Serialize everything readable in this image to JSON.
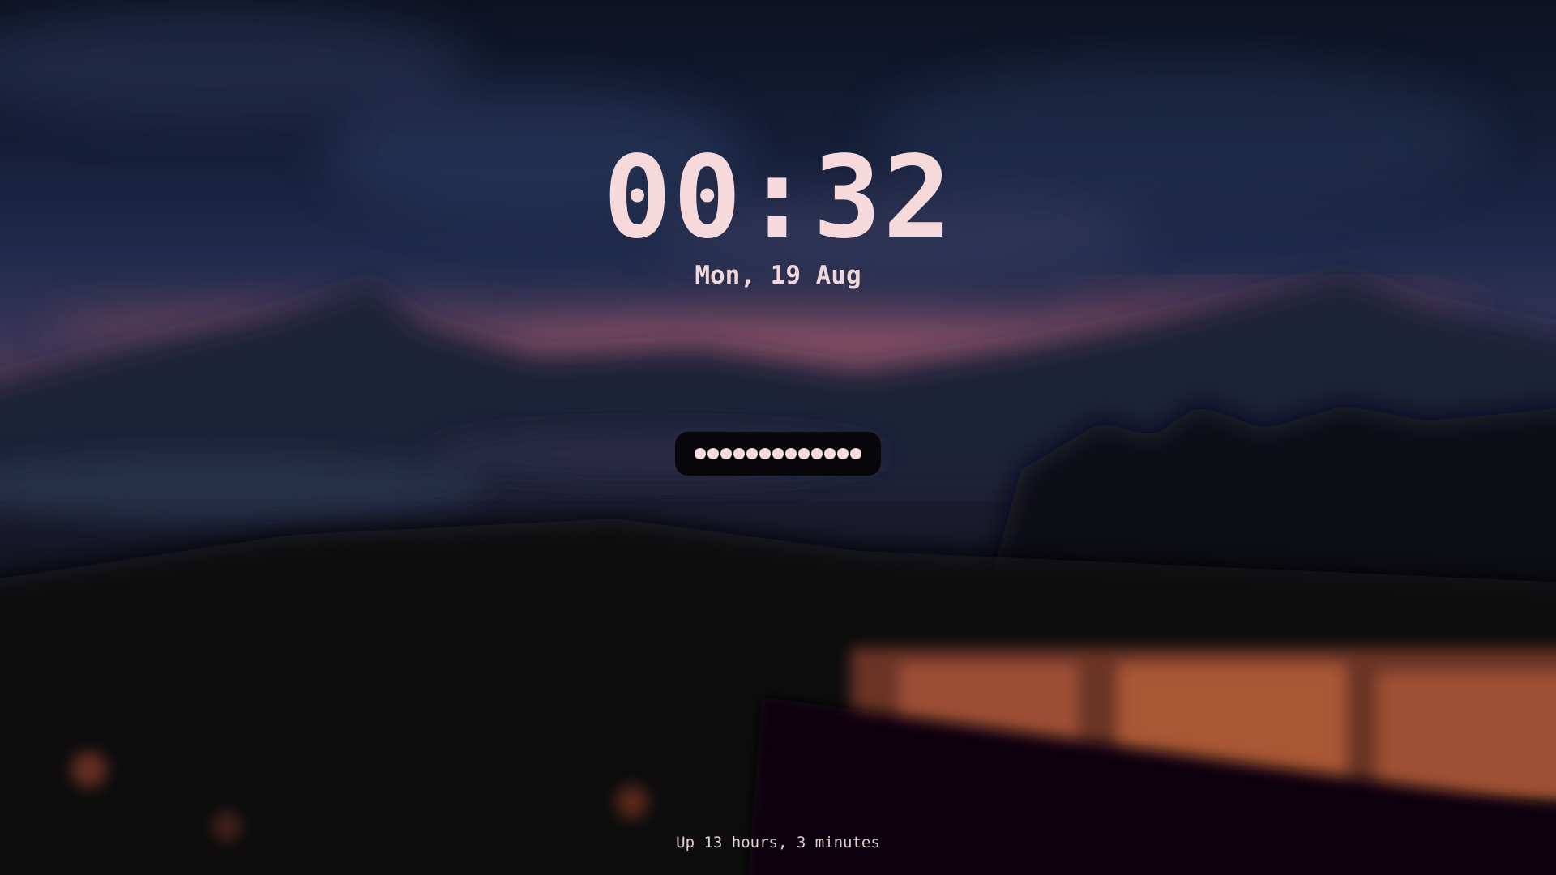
{
  "lockscreen": {
    "time": "00:32",
    "date": "Mon, 19 Aug",
    "password": {
      "masked_length": 13,
      "dot_color": "#f6d9da",
      "field_background": "#07060a"
    },
    "uptime": "Up 13 hours, 3 minutes"
  },
  "colors": {
    "text": "#f6d9da",
    "sky_top": "#0c1020",
    "sky_mid": "#1d2848",
    "horizon_glow": "#b8606a",
    "window_glow": "#d9764e"
  }
}
